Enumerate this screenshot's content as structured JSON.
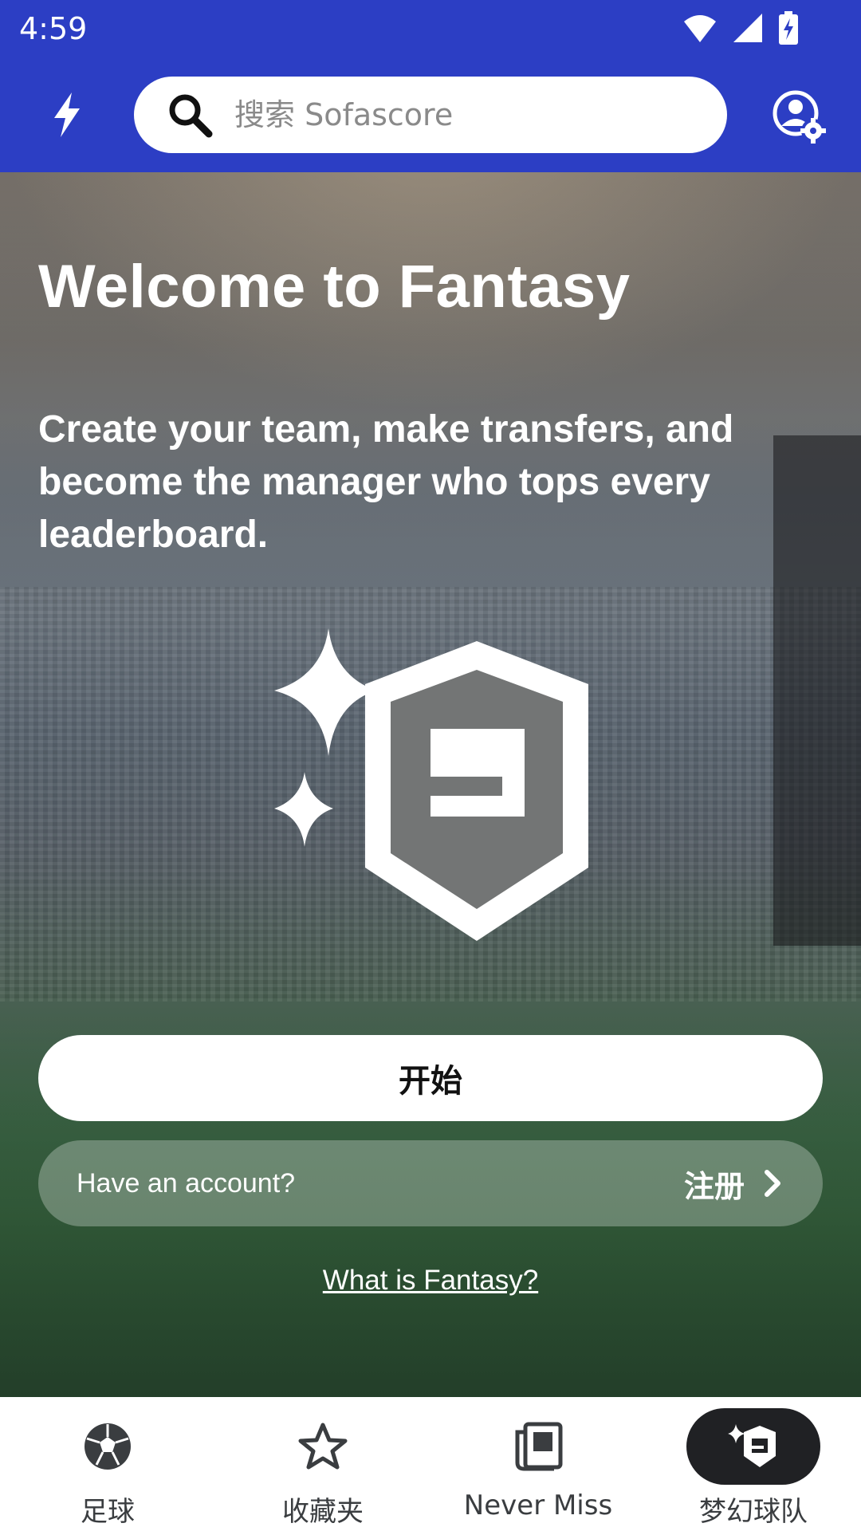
{
  "status_bar": {
    "time": "4:59"
  },
  "app_bar": {
    "search_placeholder": "搜索 Sofascore"
  },
  "hero": {
    "title": "Welcome to Fantasy",
    "subtitle": "Create your team, make transfers, and become the manager who tops every leaderboard.",
    "start_label": "开始",
    "account_prompt": "Have an account?",
    "signup_label": "注册",
    "what_is_link": "What is Fantasy?"
  },
  "bottom_nav": {
    "items": [
      {
        "label": "足球",
        "icon": "soccer-ball-icon",
        "active": false
      },
      {
        "label": "收藏夹",
        "icon": "star-icon",
        "active": false
      },
      {
        "label": "Never Miss",
        "icon": "news-icon",
        "active": false
      },
      {
        "label": "梦幻球队",
        "icon": "fantasy-icon",
        "active": true
      }
    ]
  },
  "colors": {
    "brand": "#2c3ec4",
    "nav_active": "#202124"
  }
}
